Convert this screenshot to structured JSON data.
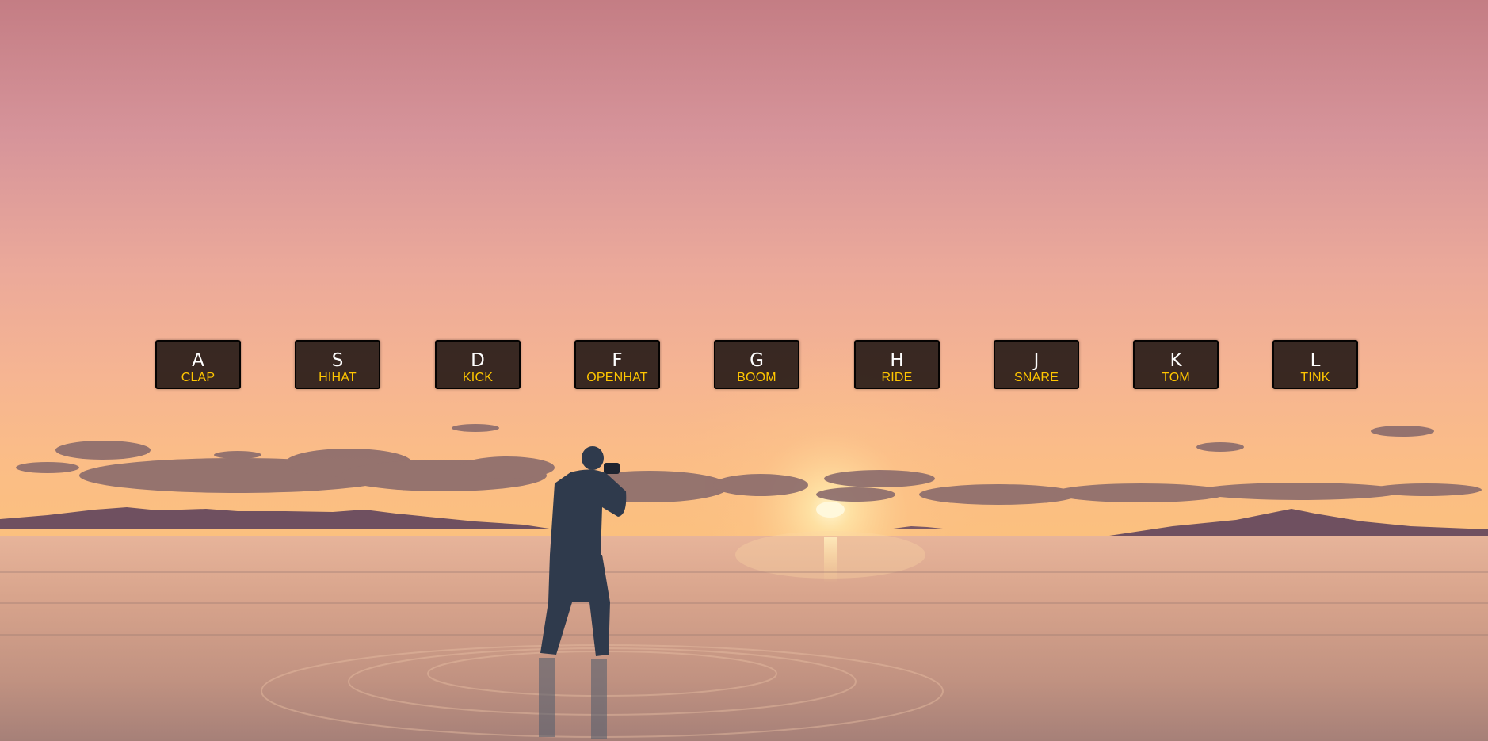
{
  "keys": [
    {
      "letter": "A",
      "sound": "CLAP"
    },
    {
      "letter": "S",
      "sound": "HIHAT"
    },
    {
      "letter": "D",
      "sound": "KICK"
    },
    {
      "letter": "F",
      "sound": "OPENHAT"
    },
    {
      "letter": "G",
      "sound": "BOOM"
    },
    {
      "letter": "H",
      "sound": "RIDE"
    },
    {
      "letter": "J",
      "sound": "SNARE"
    },
    {
      "letter": "K",
      "sound": "TOM"
    },
    {
      "letter": "L",
      "sound": "TINK"
    }
  ],
  "colors": {
    "key_background": "#2a1d19",
    "key_border": "#050302",
    "letter": "#ffffff",
    "sound_label": "#ffc600"
  }
}
